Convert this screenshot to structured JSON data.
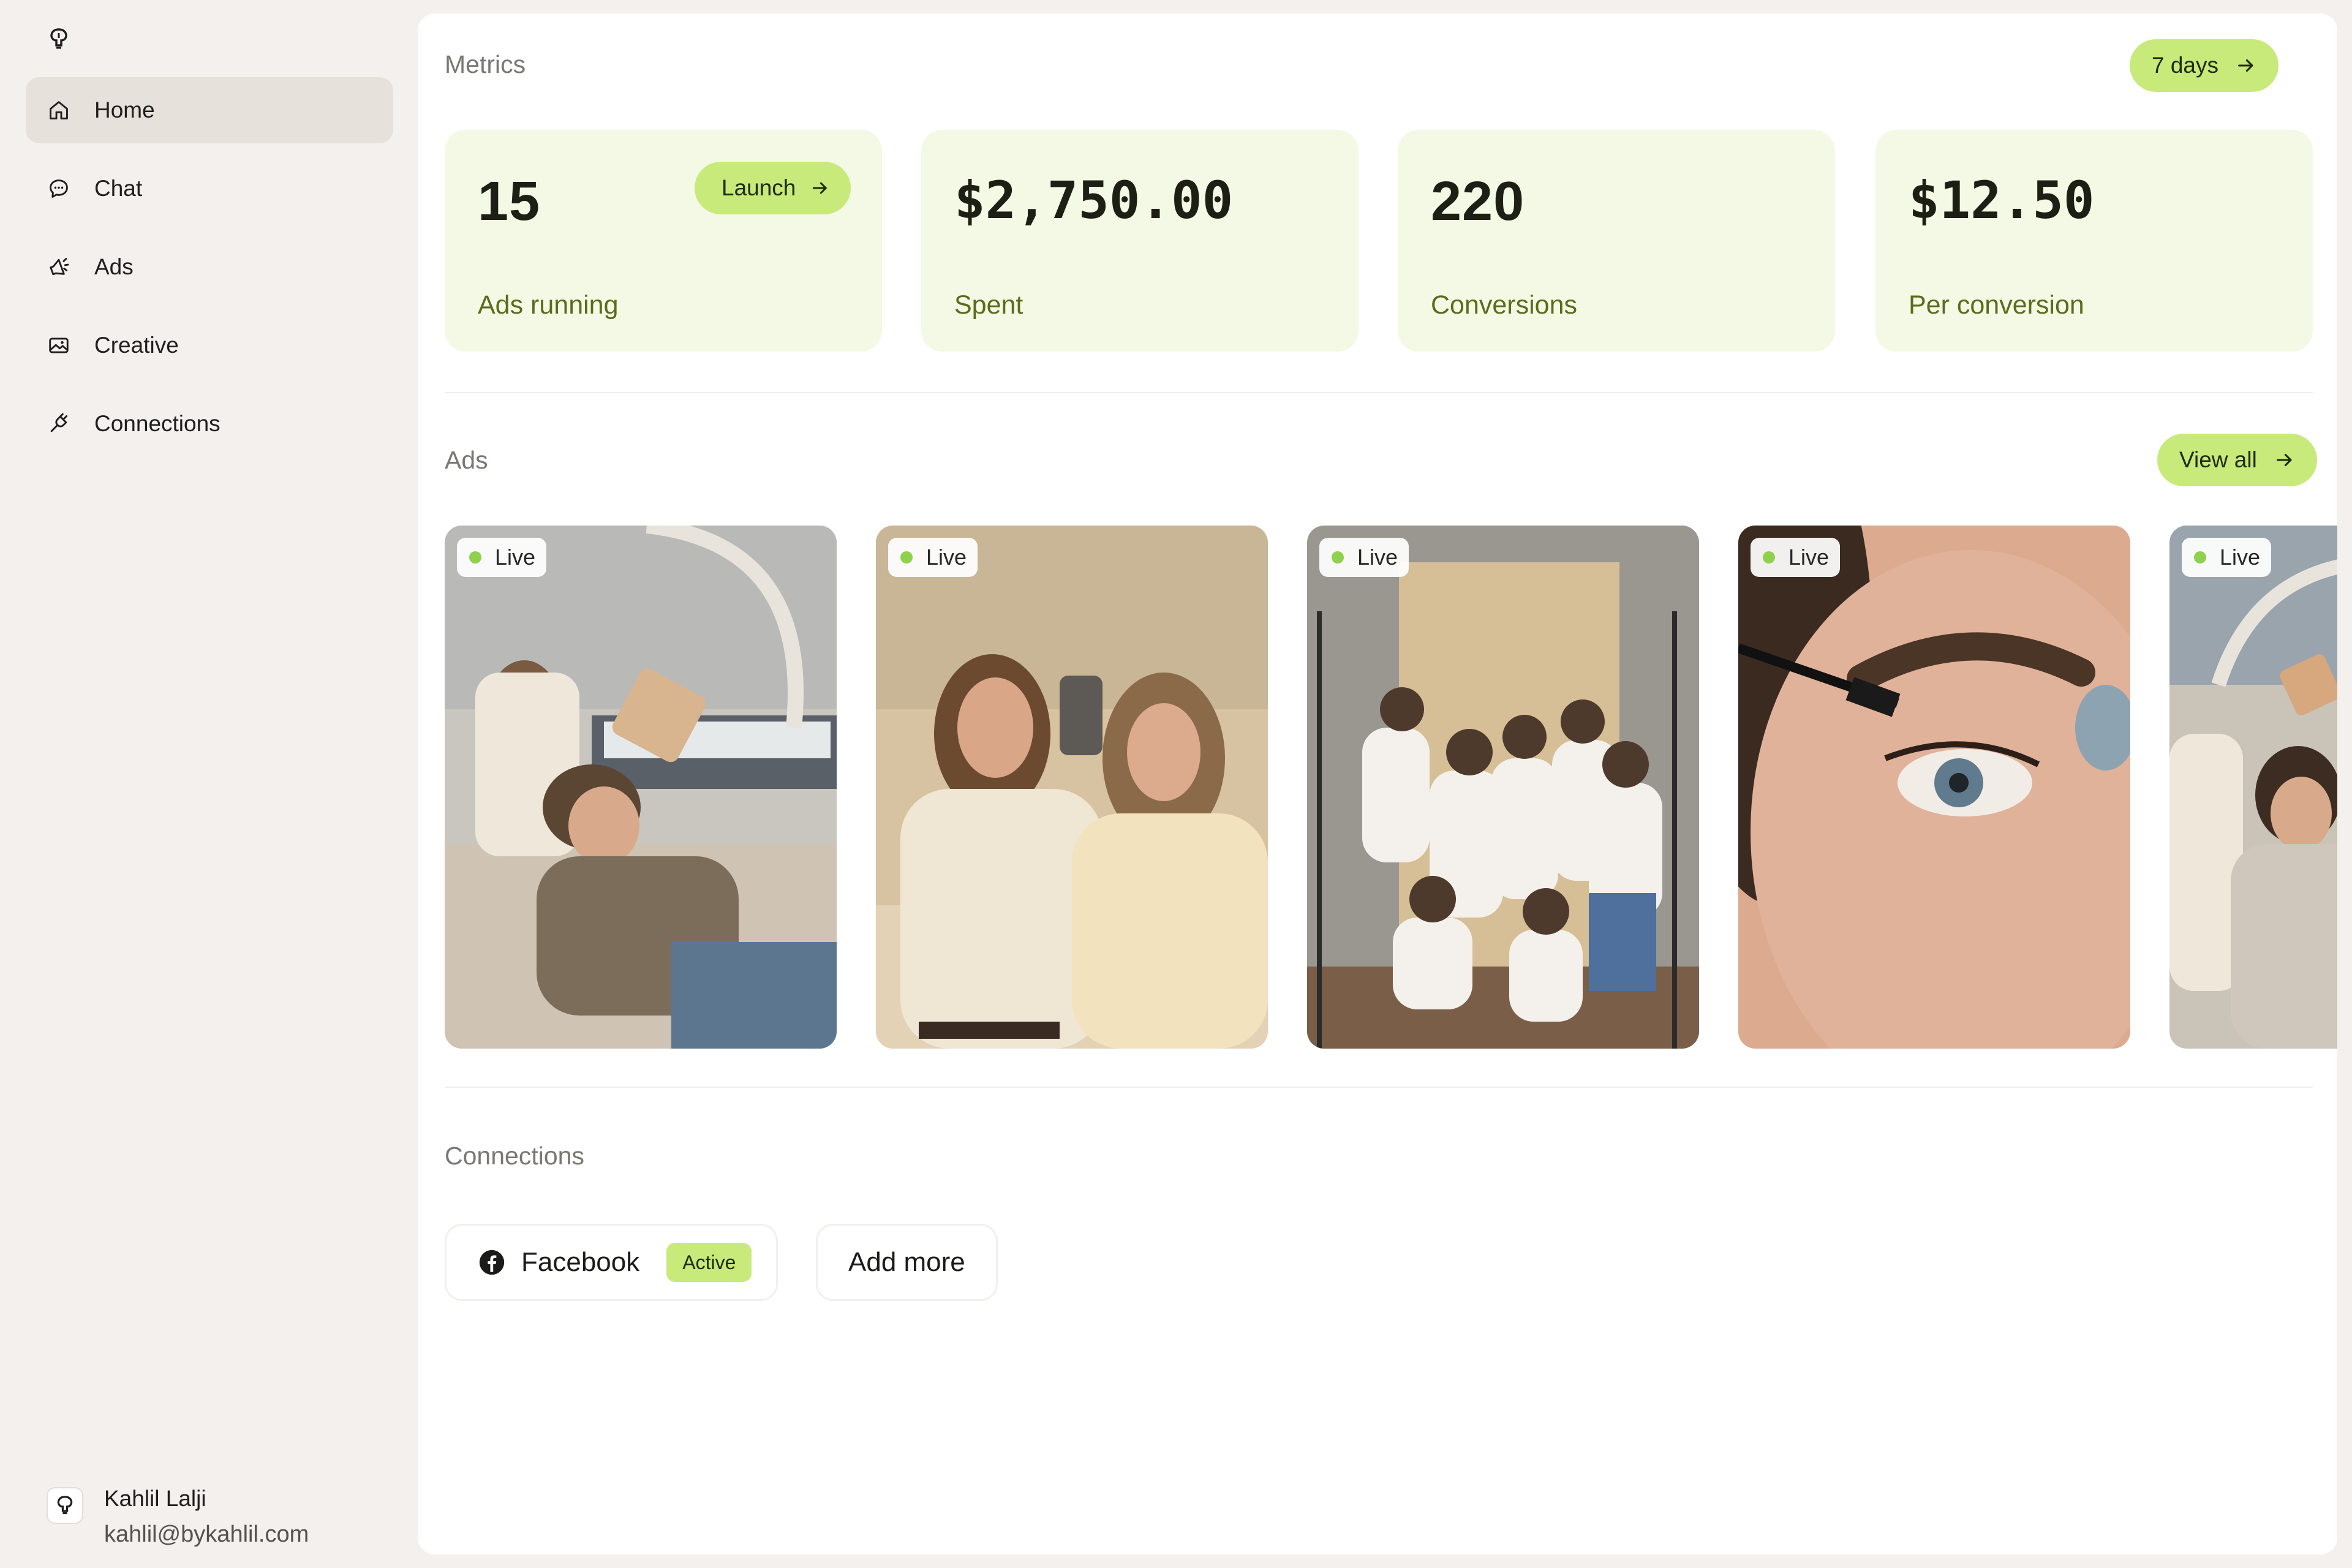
{
  "sidebar": {
    "nav": [
      {
        "label": "Home",
        "icon": "home-icon",
        "active": true
      },
      {
        "label": "Chat",
        "icon": "chat-icon",
        "active": false
      },
      {
        "label": "Ads",
        "icon": "megaphone-icon",
        "active": false
      },
      {
        "label": "Creative",
        "icon": "image-icon",
        "active": false
      },
      {
        "label": "Connections",
        "icon": "plug-icon",
        "active": false
      }
    ],
    "user": {
      "name": "Kahlil Lalji",
      "email": "kahlil@bykahlil.com"
    }
  },
  "metrics": {
    "title": "Metrics",
    "range_label": "7 days",
    "cards": [
      {
        "value": "15",
        "label": "Ads running",
        "action": "Launch"
      },
      {
        "value": "$2,750.00",
        "label": "Spent"
      },
      {
        "value": "220",
        "label": "Conversions"
      },
      {
        "value": "$12.50",
        "label": "Per conversion"
      }
    ]
  },
  "ads": {
    "title": "Ads",
    "view_all_label": "View all",
    "items": [
      {
        "status": "Live"
      },
      {
        "status": "Live"
      },
      {
        "status": "Live"
      },
      {
        "status": "Live"
      },
      {
        "status": "Live"
      }
    ]
  },
  "connections": {
    "title": "Connections",
    "items": [
      {
        "label": "Facebook",
        "badge": "Active",
        "icon": "facebook-icon"
      }
    ],
    "add_more_label": "Add more"
  },
  "colors": {
    "accent": "#c8ea7a",
    "metric_card_bg": "#f3f9e4",
    "metric_label": "#5b6b1c",
    "live_dot": "#8fd14f",
    "sidebar_bg": "#f3f0ed",
    "active_nav_bg": "#e7e1dc"
  }
}
